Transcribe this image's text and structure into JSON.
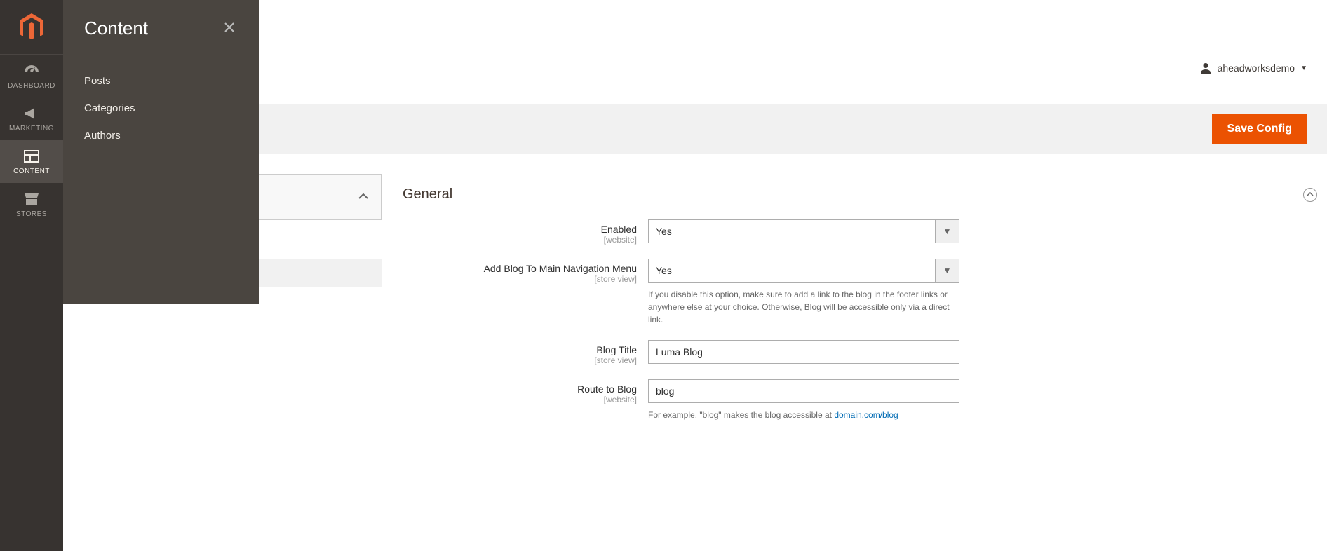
{
  "nav": {
    "items": [
      {
        "label": "DASHBOARD"
      },
      {
        "label": "MARKETING"
      },
      {
        "label": "CONTENT"
      },
      {
        "label": "STORES"
      }
    ]
  },
  "flyout": {
    "title": "Content",
    "items": [
      {
        "label": "Posts"
      },
      {
        "label": "Categories"
      },
      {
        "label": "Authors"
      }
    ]
  },
  "header": {
    "user_name": "aheadworksdemo"
  },
  "action_bar": {
    "save_label": "Save Config"
  },
  "section": {
    "title": "General",
    "fields": {
      "enabled": {
        "label": "Enabled",
        "scope": "[website]",
        "value": "Yes"
      },
      "add_nav": {
        "label": "Add Blog To Main Navigation Menu",
        "scope": "[store view]",
        "value": "Yes",
        "hint": "If you disable this option, make sure to add a link to the blog in the footer links or anywhere else at your choice. Otherwise, Blog will be accessible only via a direct link."
      },
      "blog_title": {
        "label": "Blog Title",
        "scope": "[store view]",
        "value": "Luma Blog"
      },
      "route": {
        "label": "Route to Blog",
        "scope": "[website]",
        "value": "blog",
        "hint_prefix": "For example, \"blog\" makes the blog accessible at ",
        "hint_link": "domain.com/blog"
      }
    }
  }
}
